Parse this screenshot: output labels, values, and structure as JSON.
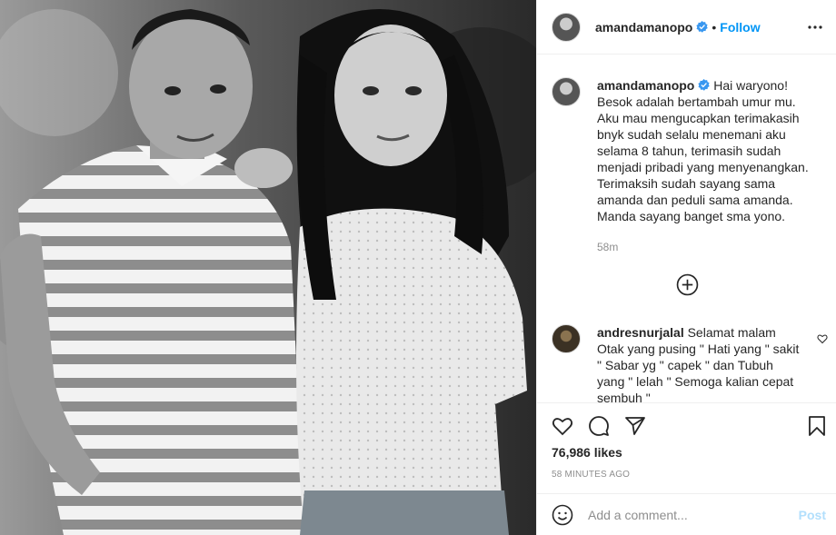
{
  "post": {
    "author": "amandamanopo",
    "follow_label": "Follow",
    "separator": "•",
    "caption_author": "amandamanopo",
    "caption_text": "Hai waryono!\nBesok adalah bertambah umur mu.\nAku mau mengucapkan terimakasih bnyk sudah selalu menemani aku selama 8 tahun, terimasih sudah menjadi pribadi yang menyenangkan.\nTerimaksih sudah sayang sama amanda dan peduli sama amanda.\nManda sayang banget sma yono.",
    "caption_time": "58m",
    "likes": "76,986 likes",
    "posted_time": "58 MINUTES AGO"
  },
  "comment": {
    "author": "andresnurjalal",
    "text": "Selamat malam\nOtak yang pusing \" Hati yang \" sakit \" Sabar yg \" capek \" dan Tubuh yang \" lelah \" Semoga kalian cepat sembuh \""
  },
  "composer": {
    "placeholder": "Add a comment...",
    "post_label": "Post"
  },
  "icons": {
    "more": "more-options-icon",
    "verified": "verified-badge-icon",
    "load_more": "plus-circle-icon",
    "like": "heart-icon",
    "comment": "comment-bubble-icon",
    "share": "paper-plane-icon",
    "save": "bookmark-icon",
    "emoji": "smiley-icon"
  },
  "colors": {
    "accent": "#0095f6",
    "post_disabled": "#b2dffc",
    "muted": "#8e8e8e"
  }
}
